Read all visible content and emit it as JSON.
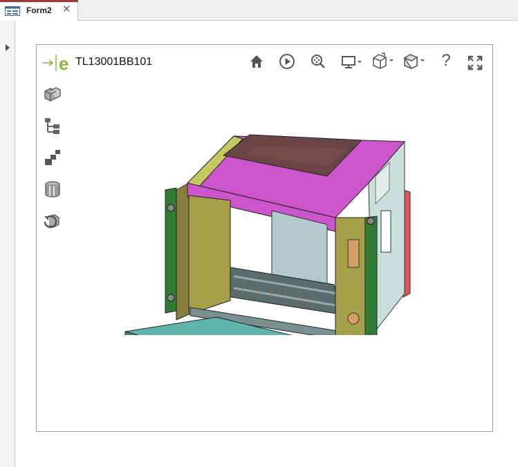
{
  "tab": {
    "label": "Form2",
    "close_glyph": "✕",
    "icon": "form-icon"
  },
  "viewer": {
    "title": "TL13001BB101",
    "brand_mark": "e",
    "toolbar": [
      "home-icon",
      "play-icon",
      "zoom-icon",
      "display-icon",
      "view-cube-icon",
      "projection-cube-icon",
      "help-icon",
      "fullscreen-icon"
    ],
    "help_glyph": "?",
    "sidebar": [
      "assembly-icon",
      "tree-icon",
      "explode-icon",
      "section-icon",
      "reset-icon"
    ]
  },
  "colors": {
    "accent": "#8db830",
    "magenta": "#cc55cc",
    "olive": "#a6a04a",
    "teal": "#5fb5ac",
    "tab_accent": "#a4373a"
  }
}
